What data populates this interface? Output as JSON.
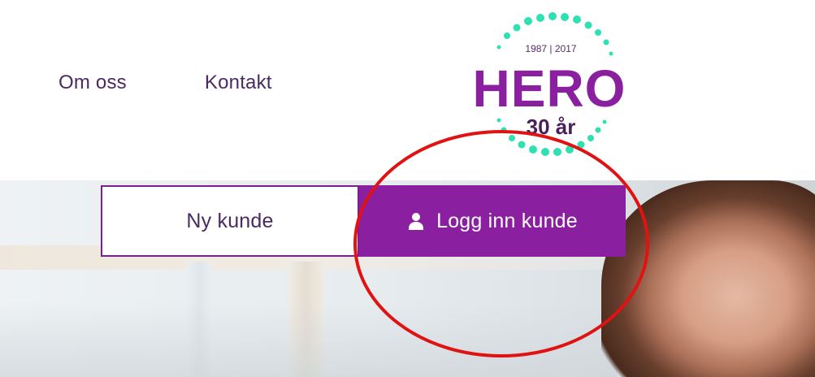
{
  "nav": {
    "items": [
      {
        "label": "Om oss"
      },
      {
        "label": "Kontakt"
      }
    ]
  },
  "logo": {
    "years": "1987 | 2017",
    "brand": "HERO",
    "anniversary": "30 år",
    "colors": {
      "brand": "#8a1fa0",
      "dots": "#2fe0b3"
    }
  },
  "actions": {
    "new_customer": "Ny kunde",
    "login_customer": "Logg inn kunde",
    "login_icon": "user-icon"
  },
  "annotation": {
    "shape": "ellipse",
    "color": "#e01212"
  }
}
